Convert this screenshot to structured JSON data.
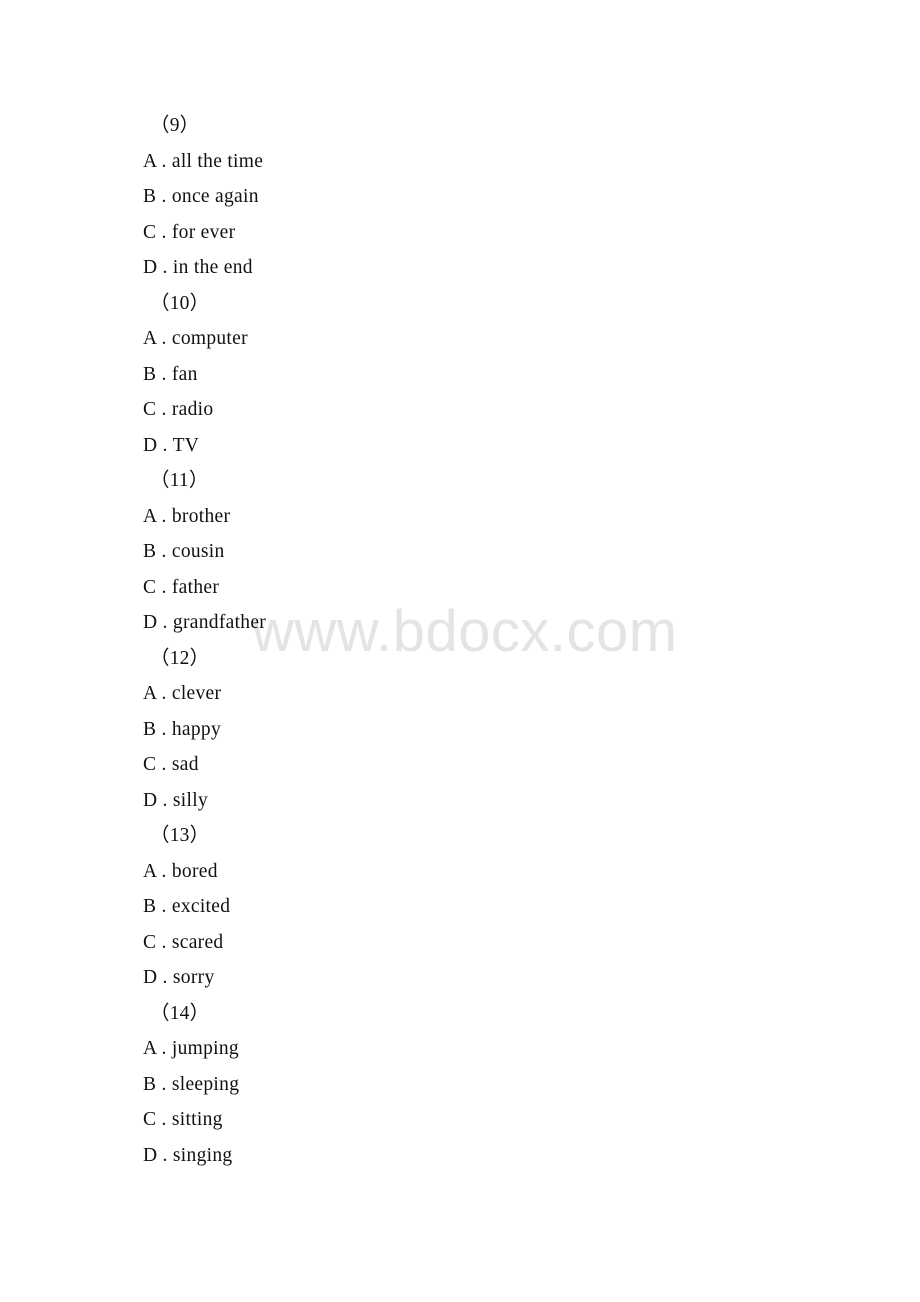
{
  "document": {
    "type": "exam-question-page",
    "background_color": "#ffffff",
    "text_color": "#111111"
  },
  "watermark": {
    "text": "www.bdocx.com",
    "color": "#e4e4e4"
  },
  "questions": [
    {
      "number": "（9）",
      "options": [
        {
          "mark": "A .",
          "text": "all the time"
        },
        {
          "mark": "B .",
          "text": "once again"
        },
        {
          "mark": "C .",
          "text": "for ever"
        },
        {
          "mark": "D .",
          "text": "in the end"
        }
      ]
    },
    {
      "number": "（10）",
      "options": [
        {
          "mark": "A .",
          "text": "computer"
        },
        {
          "mark": "B .",
          "text": "fan"
        },
        {
          "mark": "C .",
          "text": "radio"
        },
        {
          "mark": "D .",
          "text": "TV"
        }
      ]
    },
    {
      "number": "（11）",
      "options": [
        {
          "mark": "A .",
          "text": "brother"
        },
        {
          "mark": "B .",
          "text": "cousin"
        },
        {
          "mark": "C .",
          "text": "father"
        },
        {
          "mark": "D .",
          "text": "grandfather"
        }
      ]
    },
    {
      "number": "（12）",
      "options": [
        {
          "mark": "A .",
          "text": "clever"
        },
        {
          "mark": "B .",
          "text": "happy"
        },
        {
          "mark": "C .",
          "text": "sad"
        },
        {
          "mark": "D .",
          "text": "silly"
        }
      ]
    },
    {
      "number": "（13）",
      "options": [
        {
          "mark": "A .",
          "text": "bored"
        },
        {
          "mark": "B .",
          "text": "excited"
        },
        {
          "mark": "C .",
          "text": "scared"
        },
        {
          "mark": "D .",
          "text": "sorry"
        }
      ]
    },
    {
      "number": "（14）",
      "options": [
        {
          "mark": "A .",
          "text": "jumping"
        },
        {
          "mark": "B .",
          "text": "sleeping"
        },
        {
          "mark": "C .",
          "text": "sitting"
        },
        {
          "mark": "D .",
          "text": "singing"
        }
      ]
    }
  ]
}
